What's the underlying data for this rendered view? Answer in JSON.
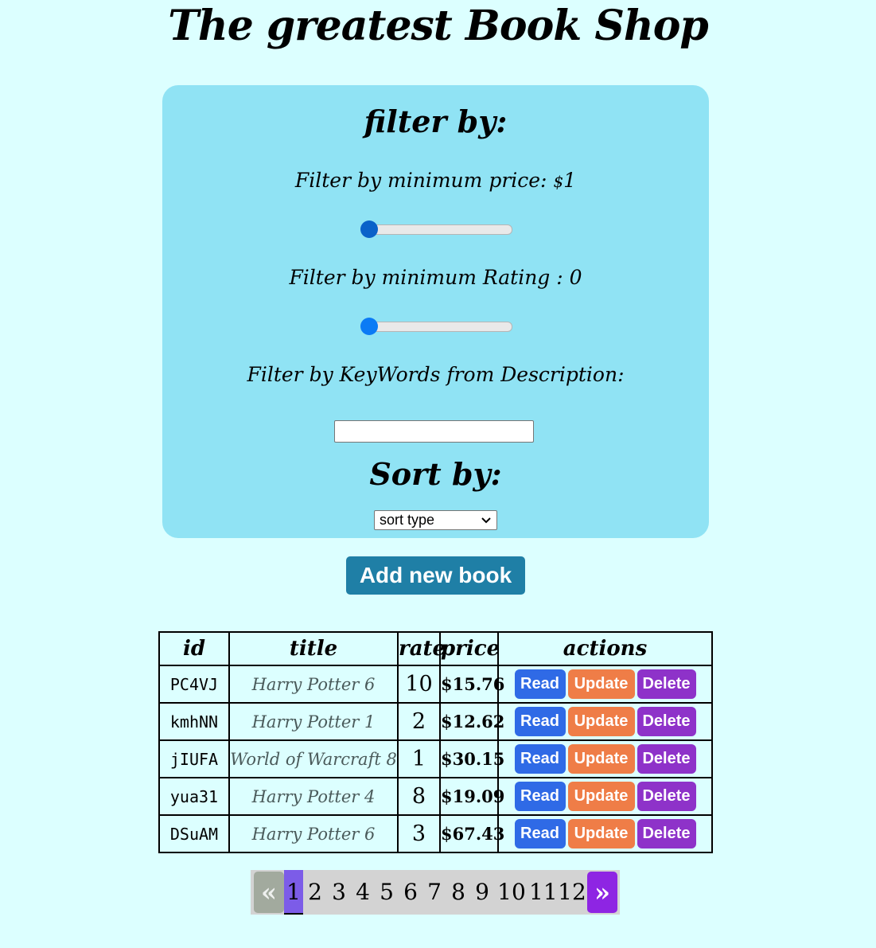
{
  "header": {
    "title": "The greatest Book Shop"
  },
  "filters": {
    "heading": "filter by:",
    "min_price_label": "Filter by minimum price:",
    "currency_symbol": "$",
    "min_price_value": "1",
    "min_price_level": 0,
    "min_rating_label": "Filter by minimum Rating :",
    "min_rating_value": "0",
    "min_rating_level": 0,
    "keywords_label": "Filter by KeyWords from Description:",
    "keywords_value": ""
  },
  "sort": {
    "heading": "Sort by:",
    "selected": "sort type",
    "chevron_icon": "chevron-down-icon"
  },
  "actions": {
    "add_book_label": "Add new book"
  },
  "table": {
    "headers": [
      "id",
      "title",
      "rate",
      "price",
      "actions"
    ],
    "button_labels": {
      "read": "Read",
      "update": "Update",
      "delete": "Delete"
    },
    "rows": [
      {
        "id": "PC4VJ",
        "title": "Harry Potter 6",
        "rate": "10",
        "price": "$15.76"
      },
      {
        "id": "kmhNN",
        "title": "Harry Potter 1",
        "rate": "2",
        "price": "$12.62"
      },
      {
        "id": "jIUFA",
        "title": "World of Warcraft 8",
        "rate": "1",
        "price": "$30.15"
      },
      {
        "id": "yua31",
        "title": "Harry Potter 4",
        "rate": "8",
        "price": "$19.09"
      },
      {
        "id": "DSuAM",
        "title": "Harry Potter 6",
        "rate": "3",
        "price": "$67.43"
      }
    ]
  },
  "pagination": {
    "prev_label": "«",
    "next_label": "»",
    "current_page": "1",
    "pages": [
      "1",
      "2",
      "3",
      "4",
      "5",
      "6",
      "7",
      "8",
      "9",
      "10",
      "11",
      "12"
    ]
  },
  "colors": {
    "page_background": "#dcffff",
    "panel_background": "#90e3f4",
    "add_button": "#1f7fa6",
    "read_button": "#2f6ae6",
    "update_button": "#ef7d47",
    "delete_button": "#8e32c9",
    "active_page": "#7c5ce8",
    "next_arrow": "#8e25e3"
  }
}
